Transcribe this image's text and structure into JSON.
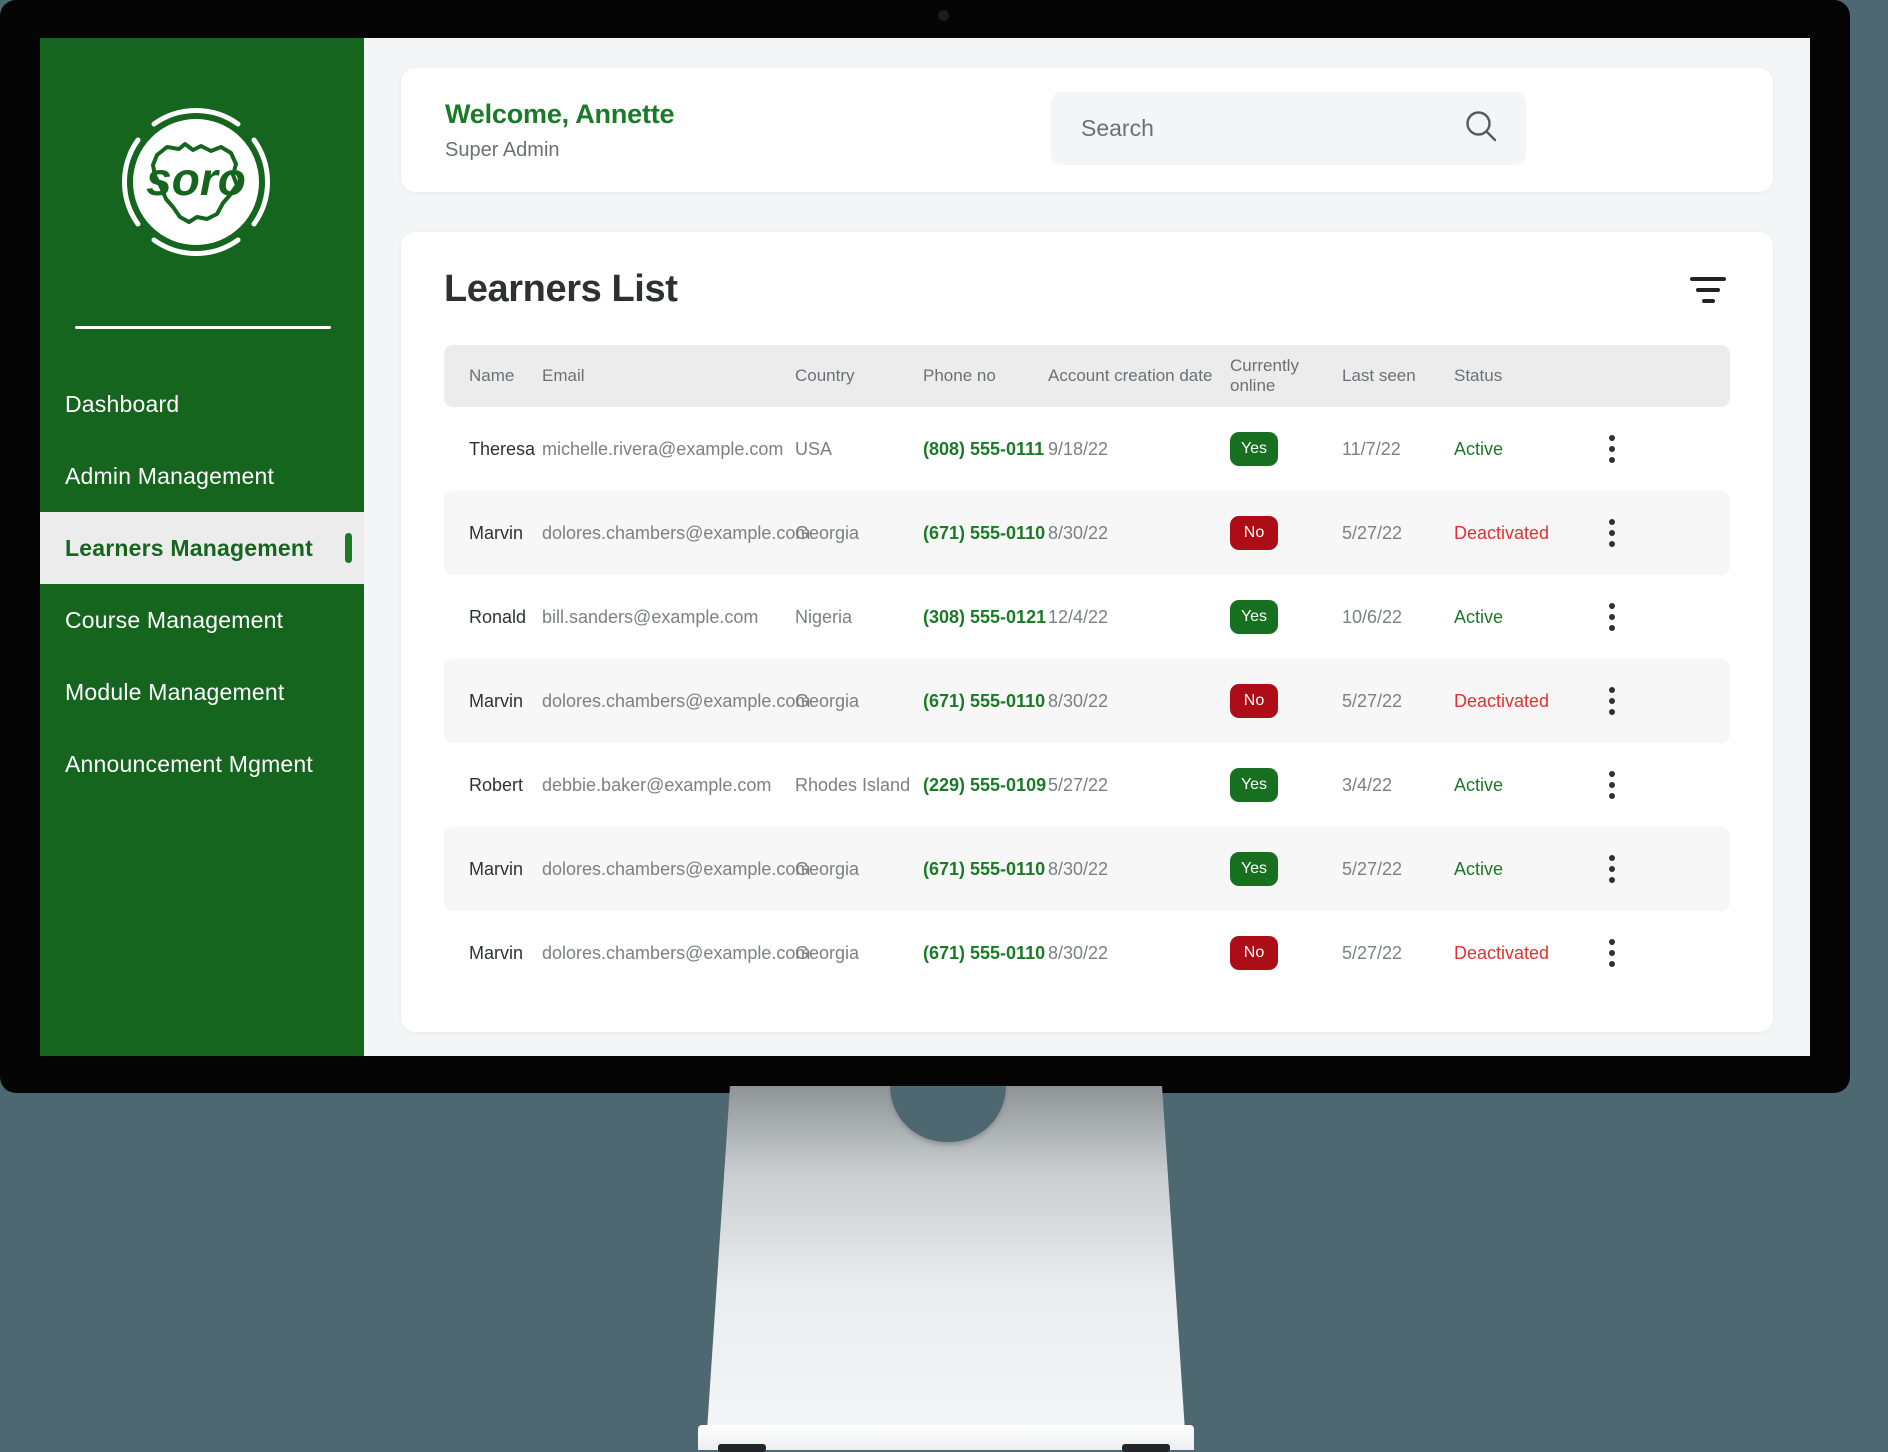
{
  "brand": {
    "logo_text": "soro",
    "logo_alt": "soro-logo"
  },
  "sidebar": {
    "items": [
      {
        "label": "Dashboard",
        "active": false
      },
      {
        "label": "Admin Management",
        "active": false
      },
      {
        "label": "Learners Management",
        "active": true
      },
      {
        "label": "Course Management",
        "active": false
      },
      {
        "label": "Module Management",
        "active": false
      },
      {
        "label": "Announcement Mgment",
        "active": false
      }
    ]
  },
  "header": {
    "welcome_title": "Welcome, Annette",
    "role": "Super Admin",
    "search_placeholder": "Search",
    "search_value": ""
  },
  "main": {
    "title": "Learners List",
    "columns": [
      "Name",
      "Email",
      "Country",
      "Phone no",
      "Account creation date",
      "Currently online",
      "Last seen",
      "Status"
    ],
    "rows": [
      {
        "name": "Theresa",
        "email": "michelle.rivera@example.com",
        "country": "USA",
        "phone": "(808) 555-0111",
        "created": "9/18/22",
        "online": "Yes",
        "last_seen": "11/7/22",
        "status": "Active"
      },
      {
        "name": "Marvin",
        "email": "dolores.chambers@example.com",
        "country": "Georgia",
        "phone": "(671) 555-0110",
        "created": "8/30/22",
        "online": "No",
        "last_seen": "5/27/22",
        "status": "Deactivated"
      },
      {
        "name": "Ronald",
        "email": "bill.sanders@example.com",
        "country": "Nigeria",
        "phone": "(308) 555-0121",
        "created": "12/4/22",
        "online": "Yes",
        "last_seen": "10/6/22",
        "status": "Active"
      },
      {
        "name": "Marvin",
        "email": "dolores.chambers@example.com",
        "country": "Georgia",
        "phone": "(671) 555-0110",
        "created": "8/30/22",
        "online": "No",
        "last_seen": "5/27/22",
        "status": "Deactivated"
      },
      {
        "name": "Robert",
        "email": "debbie.baker@example.com",
        "country": "Rhodes Island",
        "phone": "(229) 555-0109",
        "created": "5/27/22",
        "online": "Yes",
        "last_seen": "3/4/22",
        "status": "Active"
      },
      {
        "name": "Marvin",
        "email": "dolores.chambers@example.com",
        "country": "Georgia",
        "phone": "(671) 555-0110",
        "created": "8/30/22",
        "online": "Yes",
        "last_seen": "5/27/22",
        "status": "Active"
      },
      {
        "name": "Marvin",
        "email": "dolores.chambers@example.com",
        "country": "Georgia",
        "phone": "(671) 555-0110",
        "created": "8/30/22",
        "online": "No",
        "last_seen": "5/27/22",
        "status": "Deactivated"
      }
    ]
  },
  "icons": {
    "search": "search-icon",
    "filter": "filter-icon",
    "row_menu": "row-menu-icon"
  },
  "colors": {
    "brand_green": "#15651f",
    "accent_green": "#1a7a27",
    "danger_red": "#e03131",
    "badge_yes": "#17701f",
    "badge_no": "#ad0d16",
    "page_background": "#4d6870",
    "screen_background": "#f4f5f6"
  }
}
